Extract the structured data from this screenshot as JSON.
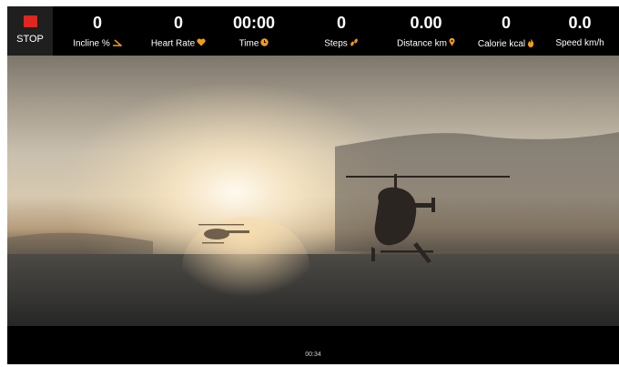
{
  "controls": {
    "stop_label": "STOP"
  },
  "stats": [
    {
      "value": "0",
      "label": "Incline %",
      "icon": "incline-icon"
    },
    {
      "value": "0",
      "label": "Heart Rate",
      "icon": "heart-icon"
    },
    {
      "value": "00:00",
      "label": "Time",
      "icon": "clock-icon"
    },
    {
      "value": "0",
      "label": "Steps",
      "icon": "footsteps-icon"
    },
    {
      "value": "0.00",
      "label": "Distance km",
      "icon": "distance-icon"
    },
    {
      "value": "0",
      "label": "Calorie kcal",
      "icon": "flame-icon"
    },
    {
      "value": "0.0",
      "label": "Speed km/h",
      "icon": "speed-icon"
    }
  ],
  "video": {
    "timestamp": "00:34"
  },
  "colors": {
    "accent": "#f39c12",
    "stop": "#e0261f",
    "bar": "#000000"
  }
}
